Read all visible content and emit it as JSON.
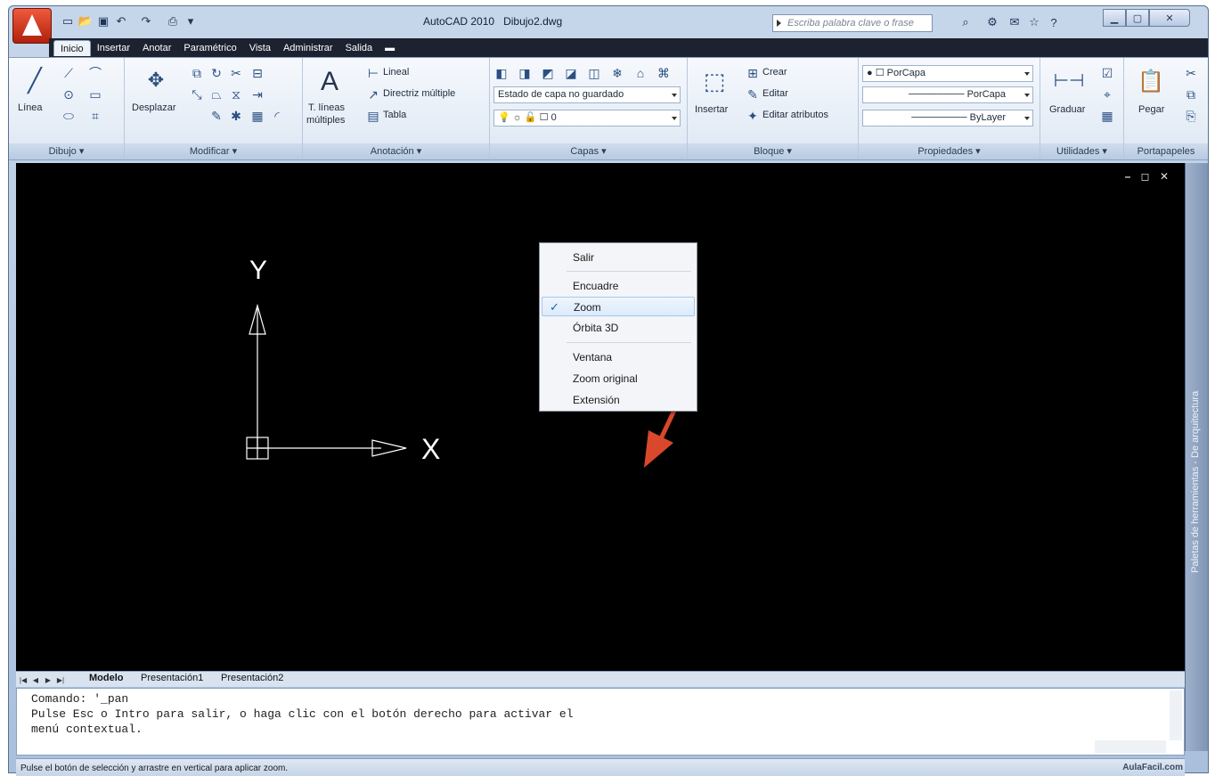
{
  "window": {
    "app_name": "AutoCAD 2010",
    "file_name": "Dibujo2.dwg"
  },
  "search": {
    "placeholder": "Escriba palabra clave o frase"
  },
  "tabs": [
    "Inicio",
    "Insertar",
    "Anotar",
    "Paramétrico",
    "Vista",
    "Administrar",
    "Salida"
  ],
  "active_tab": "Inicio",
  "ribbon": {
    "draw": {
      "title": "Dibujo",
      "line_label": "Línea"
    },
    "modify": {
      "title": "Modificar",
      "move_label": "Desplazar"
    },
    "annotation": {
      "title": "Anotación",
      "mtext_label_1": "T. líneas",
      "mtext_label_2": "múltiples",
      "linear_label": "Lineal",
      "multileader_label": "Directriz múltiple",
      "table_label": "Tabla"
    },
    "layers": {
      "title": "Capas",
      "layer_state": "Estado de capa no guardado",
      "current_layer": "0"
    },
    "block": {
      "title": "Bloque",
      "insert_label": "Insertar",
      "create_label": "Crear",
      "edit_label": "Editar",
      "edit_attrib_label": "Editar atributos"
    },
    "properties": {
      "title": "Propiedades",
      "color": "PorCapa",
      "linetype": "PorCapa",
      "lineweight": "ByLayer"
    },
    "utilities": {
      "title": "Utilidades",
      "measure_label": "Graduar"
    },
    "clipboard": {
      "title": "Portapapeles",
      "paste_label": "Pegar"
    }
  },
  "drawing": {
    "ucs_y_label": "Y",
    "ucs_x_label": "X",
    "viewport_controls": "– ◻ ✕"
  },
  "context_menu": {
    "items": [
      {
        "label": "Salir",
        "checked": false
      },
      {
        "label": "Encuadre",
        "checked": false
      },
      {
        "label": "Zoom",
        "checked": true
      },
      {
        "label": "Órbita 3D",
        "checked": false
      },
      {
        "label": "Ventana",
        "checked": false
      },
      {
        "label": "Zoom original",
        "checked": false
      },
      {
        "label": "Extensión",
        "checked": false
      }
    ],
    "check_mark": "✓"
  },
  "tool_palette": {
    "label": "Paletas de herramientas - De arquitectura"
  },
  "layout_tabs": [
    "Modelo",
    "Presentación1",
    "Presentación2"
  ],
  "command_line": {
    "line1": "Comando: '_pan",
    "line2": "Pulse Esc o Intro para salir, o haga clic con el botón derecho para activar el",
    "line3": "menú contextual."
  },
  "status_bar": {
    "text": "Pulse el botón de selección y arrastre en vertical para aplicar zoom."
  },
  "watermark": "AulaFacil.com",
  "colors": {
    "title_bar": "#c6d6ea",
    "tab_bar": "#1c2230",
    "drawing_bg": "#000000",
    "arrow": "#d9482b"
  }
}
